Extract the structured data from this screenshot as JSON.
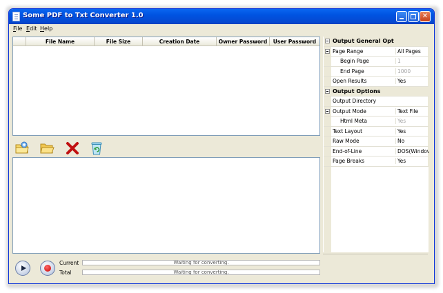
{
  "window": {
    "title": "Some PDF to Txt Converter 1.0"
  },
  "menu": {
    "items": [
      "File",
      "Edit",
      "Help"
    ]
  },
  "file_table": {
    "columns": [
      "File Name",
      "File Size",
      "Creation Date",
      "Owner Password",
      "User Password"
    ],
    "rows": []
  },
  "toolbar": {
    "icons": [
      "add-files-icon",
      "open-folder-icon",
      "delete-icon",
      "clear-list-icon"
    ]
  },
  "progress": {
    "current_label": "Current",
    "total_label": "Total",
    "current_status": "Waiting for converting.",
    "total_status": "Waiting for converting."
  },
  "properties": {
    "general_category": "Output General Options",
    "page_range_label": "Page Range",
    "page_range_value": "All Pages",
    "begin_page_label": "Begin Page",
    "begin_page_value": "1",
    "end_page_label": "End Page",
    "end_page_value": "1000",
    "open_results_label": "Open Results",
    "open_results_value": "Yes",
    "output_category": "Output Options",
    "output_directory_label": "Output Directory",
    "output_directory_value": "",
    "output_mode_label": "Output Mode",
    "output_mode_value": "Text File",
    "html_meta_label": "Html Meta",
    "html_meta_value": "Yes",
    "text_layout_label": "Text Layout",
    "text_layout_value": "Yes",
    "raw_mode_label": "Raw Mode",
    "raw_mode_value": "No",
    "end_of_line_label": "End-of-Line",
    "end_of_line_value": "DOS(Windows",
    "page_breaks_label": "Page Breaks",
    "page_breaks_value": "Yes"
  },
  "colors": {
    "titlebar": "#0053e1",
    "window_bg": "#ece9d8",
    "border": "#7f9db9"
  }
}
